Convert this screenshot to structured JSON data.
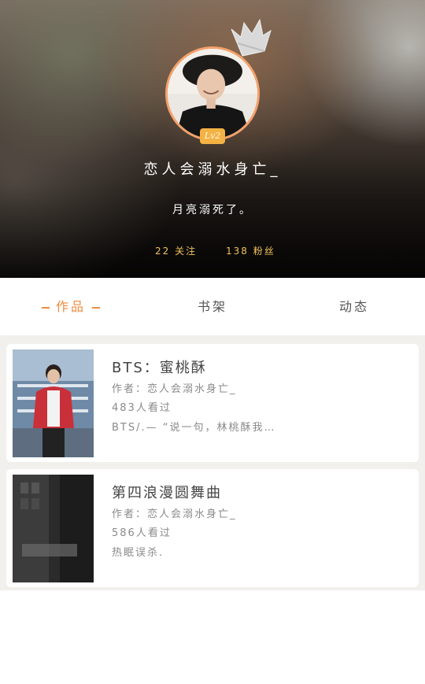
{
  "profile": {
    "level": "Lv2",
    "username": "恋人会溺水身亡_",
    "signature": "月亮溺死了。",
    "following": "22 关注",
    "fans": "138 粉丝"
  },
  "tabs": [
    {
      "label": "作品",
      "active": true
    },
    {
      "label": "书架",
      "active": false
    },
    {
      "label": "动态",
      "active": false
    }
  ],
  "works": [
    {
      "title": "BTS：蜜桃酥",
      "author": "作者：恋人会溺水身亡_",
      "views": "483人看过",
      "excerpt": "BTS/.— “说一句，林桃酥我…"
    },
    {
      "title": "第四浪漫圆舞曲",
      "author": "作者：恋人会溺水身亡_",
      "views": "586人看过",
      "excerpt": "热眠误杀."
    }
  ],
  "colors": {
    "accent": "#ef8b3d",
    "badge": "#f3b243",
    "avatar_ring": "#f4a26b",
    "stats_text": "#f0c25a",
    "list_bg": "#f1f0ec"
  },
  "icons": {
    "crown": "crown-icon"
  }
}
